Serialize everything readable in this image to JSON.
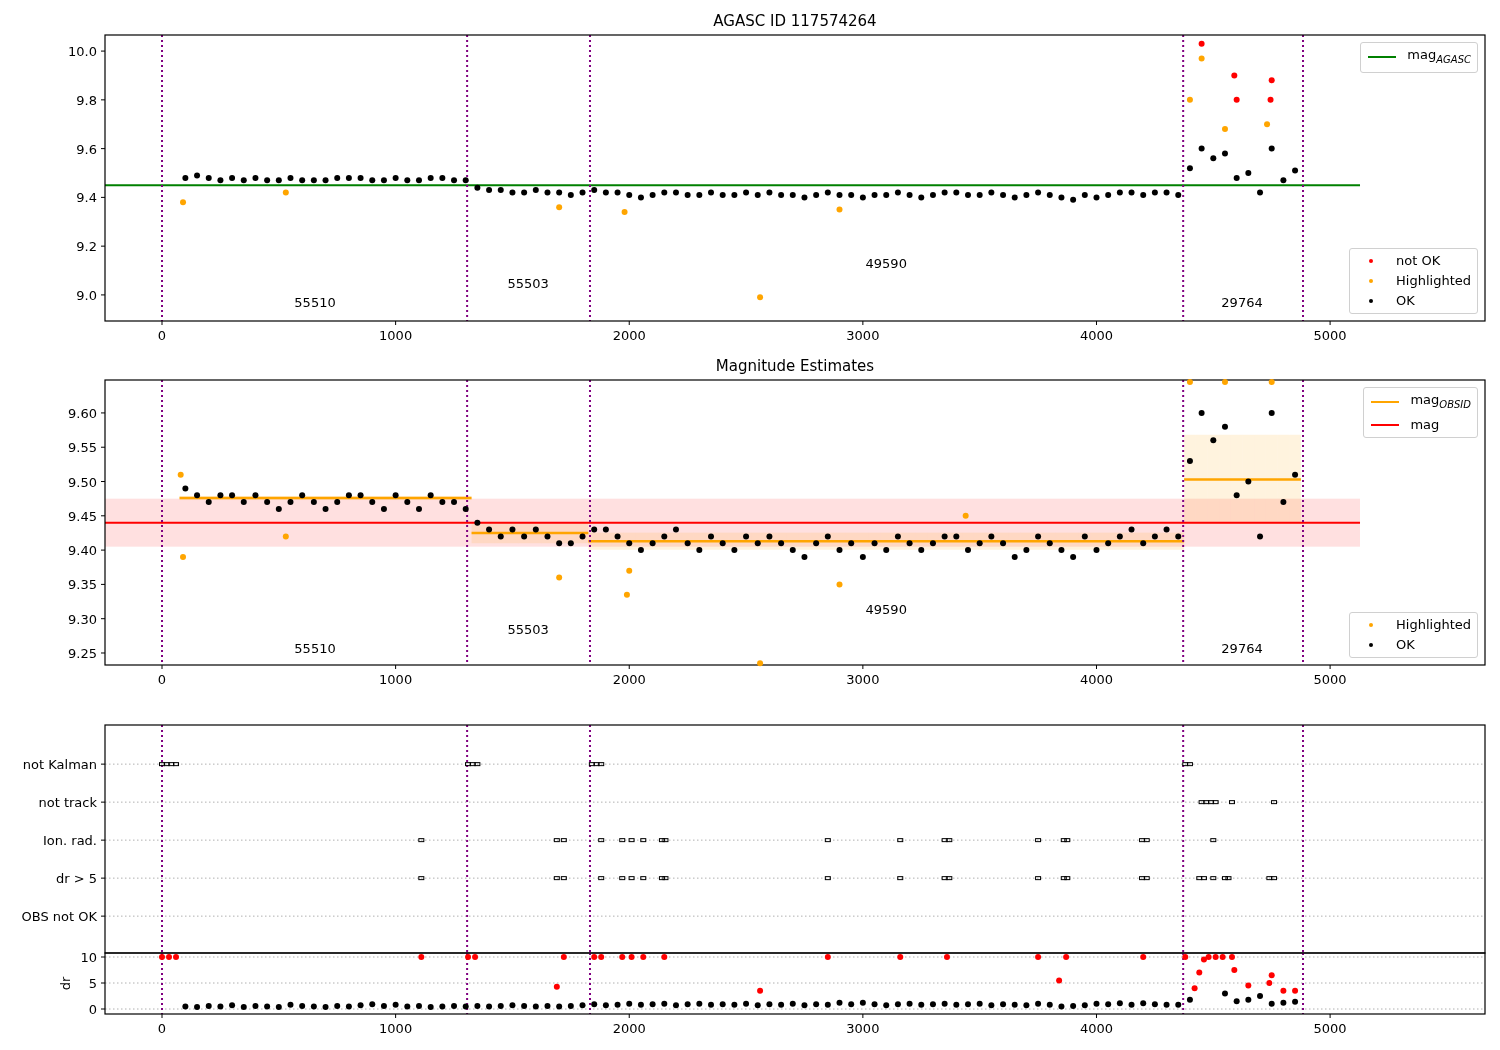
{
  "charts": [
    {
      "chart_data": {
        "type": "scatter",
        "title": "AGASC ID 117574264",
        "legend": true,
        "xlim": [
          -244,
          5663
        ],
        "ylim": [
          8.893,
          10.066
        ],
        "xticks": [
          0,
          1000,
          2000,
          3000,
          4000,
          5000
        ],
        "yticks": [
          {
            "value": 9,
            "label": "9.0"
          },
          {
            "value": 9.2,
            "label": "9.2"
          },
          {
            "value": 9.4,
            "label": "9.4"
          },
          {
            "value": 9.6,
            "label": "9.6"
          },
          {
            "value": 9.8,
            "label": "9.8"
          },
          {
            "value": 10,
            "label": "10.0"
          }
        ],
        "series": [
          {
            "name": "not OK",
            "color": "#ff0000",
            "x": [
              4450,
              4590,
              4600,
              4745,
              4750
            ],
            "values": [
              10.03,
              9.9,
              9.8,
              9.8,
              9.88
            ]
          },
          {
            "name": "Highlighted",
            "color": "#ffa500",
            "x": [
              90,
              530,
              1700,
              1980,
              2560,
              2900,
              4400,
              4450,
              4550,
              4730
            ],
            "values": [
              9.38,
              9.42,
              9.36,
              9.34,
              8.99,
              9.35,
              9.8,
              9.97,
              9.68,
              9.7
            ]
          },
          {
            "name": "OK",
            "color": "#000000",
            "x": [
              100,
              150,
              200,
              250,
              300,
              350,
              400,
              450,
              500,
              550,
              600,
              650,
              700,
              750,
              800,
              850,
              900,
              950,
              1000,
              1050,
              1100,
              1150,
              1200,
              1250,
              1300,
              1350,
              1400,
              1450,
              1500,
              1550,
              1600,
              1650,
              1700,
              1750,
              1800,
              1850,
              1900,
              1950,
              2000,
              2050,
              2100,
              2150,
              2200,
              2250,
              2300,
              2350,
              2400,
              2450,
              2500,
              2550,
              2600,
              2650,
              2700,
              2750,
              2800,
              2850,
              2900,
              2950,
              3000,
              3050,
              3100,
              3150,
              3200,
              3250,
              3300,
              3350,
              3400,
              3450,
              3500,
              3550,
              3600,
              3650,
              3700,
              3750,
              3800,
              3850,
              3900,
              3950,
              4000,
              4050,
              4100,
              4150,
              4200,
              4250,
              4300,
              4350,
              4400,
              4450,
              4500,
              4550,
              4600,
              4650,
              4700,
              4750,
              4800,
              4850
            ],
            "values": [
              9.48,
              9.49,
              9.48,
              9.47,
              9.48,
              9.47,
              9.48,
              9.47,
              9.47,
              9.48,
              9.47,
              9.47,
              9.47,
              9.48,
              9.48,
              9.48,
              9.47,
              9.47,
              9.48,
              9.47,
              9.47,
              9.48,
              9.48,
              9.47,
              9.47,
              9.44,
              9.43,
              9.43,
              9.42,
              9.42,
              9.43,
              9.42,
              9.42,
              9.41,
              9.42,
              9.43,
              9.42,
              9.42,
              9.41,
              9.4,
              9.41,
              9.42,
              9.42,
              9.41,
              9.41,
              9.42,
              9.41,
              9.41,
              9.42,
              9.41,
              9.42,
              9.41,
              9.41,
              9.4,
              9.41,
              9.42,
              9.41,
              9.41,
              9.4,
              9.41,
              9.41,
              9.42,
              9.41,
              9.4,
              9.41,
              9.42,
              9.42,
              9.41,
              9.41,
              9.42,
              9.41,
              9.4,
              9.41,
              9.42,
              9.41,
              9.4,
              9.39,
              9.41,
              9.4,
              9.41,
              9.42,
              9.42,
              9.41,
              9.42,
              9.42,
              9.41,
              9.52,
              9.6,
              9.56,
              9.58,
              9.48,
              9.5,
              9.42,
              9.6,
              9.47,
              9.51
            ]
          }
        ],
        "ref_lines": [
          {
            "axis": "y",
            "value": 9.45,
            "color": "#008000",
            "label": "mag$_{AGASC}$"
          },
          {
            "axis": "x",
            "value": 0,
            "color": "#800080"
          },
          {
            "axis": "x",
            "value": 1306,
            "color": "#800080"
          },
          {
            "axis": "x",
            "value": 1832,
            "color": "#800080"
          },
          {
            "axis": "x",
            "value": 4371,
            "color": "#800080"
          },
          {
            "axis": "x",
            "value": 4884,
            "color": "#800080"
          }
        ],
        "annotations": [
          "55510",
          "55503",
          "49590",
          "29764"
        ]
      }
    },
    {
      "chart_data": {
        "type": "scatter",
        "title": "Magnitude Estimates",
        "legend": true,
        "xlim": [
          -244,
          5663
        ],
        "ylim": [
          9.2325,
          9.648
        ],
        "xticks": [
          0,
          1000,
          2000,
          3000,
          4000,
          5000
        ],
        "yticks": [
          {
            "value": 9.25,
            "label": "9.25"
          },
          {
            "value": 9.3,
            "label": "9.30"
          },
          {
            "value": 9.35,
            "label": "9.35"
          },
          {
            "value": 9.4,
            "label": "9.40"
          },
          {
            "value": 9.45,
            "label": "9.45"
          },
          {
            "value": 9.5,
            "label": "9.50"
          },
          {
            "value": 9.55,
            "label": "9.55"
          },
          {
            "value": 9.6,
            "label": "9.60"
          }
        ],
        "series": [
          {
            "name": "mag$_{OBSID}$",
            "type": "line",
            "color": "#ffa500",
            "x": [
              100,
              150,
              200,
              250,
              300,
              350,
              400,
              450,
              500,
              550,
              600,
              650,
              700,
              750,
              800,
              850,
              900,
              950,
              1000,
              1050,
              1100,
              1150,
              1200,
              1250,
              1300,
              1350,
              1400,
              1450,
              1500,
              1550,
              1600,
              1650,
              1700,
              1750,
              1800,
              1850,
              1900,
              1950,
              2000,
              2050,
              2100,
              2150,
              2200,
              2250,
              2300,
              2350,
              2400,
              2450,
              2500,
              2550,
              2600,
              2650,
              2700,
              2750,
              2800,
              2850,
              2900,
              2950,
              3000,
              3050,
              3100,
              3150,
              3200,
              3250,
              3300,
              3350,
              3400,
              3450,
              3500,
              3550,
              3600,
              3650,
              3700,
              3750,
              3800,
              3850,
              3900,
              3950,
              4000,
              4050,
              4100,
              4150,
              4200,
              4250,
              4300,
              4350,
              4400,
              4450,
              4500,
              4550,
              4600,
              4650,
              4700,
              4750,
              4800,
              4850
            ],
            "values": [
              9.476,
              9.476,
              9.476,
              9.476,
              9.476,
              9.476,
              9.476,
              9.476,
              9.476,
              9.476,
              9.476,
              9.476,
              9.476,
              9.476,
              9.476,
              9.476,
              9.476,
              9.476,
              9.476,
              9.476,
              9.476,
              9.476,
              9.476,
              9.476,
              9.476,
              9.425,
              9.425,
              9.425,
              9.425,
              9.425,
              9.425,
              9.425,
              9.425,
              9.425,
              9.425,
              9.413,
              9.413,
              9.413,
              9.413,
              9.413,
              9.413,
              9.413,
              9.413,
              9.413,
              9.413,
              9.413,
              9.413,
              9.413,
              9.413,
              9.413,
              9.413,
              9.413,
              9.413,
              9.413,
              9.413,
              9.413,
              9.413,
              9.413,
              9.413,
              9.413,
              9.413,
              9.413,
              9.413,
              9.413,
              9.413,
              9.413,
              9.413,
              9.413,
              9.413,
              9.413,
              9.413,
              9.413,
              9.413,
              9.413,
              9.413,
              9.413,
              9.413,
              9.413,
              9.413,
              9.413,
              9.413,
              9.413,
              9.413,
              9.413,
              9.413,
              9.413,
              9.503,
              9.503,
              9.503,
              9.503,
              9.503,
              9.503,
              9.503,
              9.503,
              9.503,
              9.503
            ],
            "errors": [
              0.003,
              0.003,
              0.003,
              0.003,
              0.003,
              0.003,
              0.003,
              0.003,
              0.003,
              0.003,
              0.003,
              0.003,
              0.003,
              0.003,
              0.003,
              0.003,
              0.003,
              0.003,
              0.003,
              0.003,
              0.003,
              0.003,
              0.003,
              0.003,
              0.003,
              0.015,
              0.015,
              0.015,
              0.015,
              0.015,
              0.015,
              0.015,
              0.015,
              0.015,
              0.015,
              0.0125,
              0.0125,
              0.0125,
              0.0125,
              0.0125,
              0.0125,
              0.0125,
              0.0125,
              0.0125,
              0.0125,
              0.0125,
              0.0125,
              0.0125,
              0.0125,
              0.0125,
              0.0125,
              0.0125,
              0.0125,
              0.0125,
              0.0125,
              0.0125,
              0.0125,
              0.0125,
              0.0125,
              0.0125,
              0.0125,
              0.0125,
              0.0125,
              0.0125,
              0.0125,
              0.0125,
              0.0125,
              0.0125,
              0.0125,
              0.0125,
              0.0125,
              0.0125,
              0.0125,
              0.0125,
              0.0125,
              0.0125,
              0.0125,
              0.0125,
              0.0125,
              0.0125,
              0.0125,
              0.0125,
              0.0125,
              0.0125,
              0.0125,
              0.0125,
              0.065,
              0.065,
              0.065,
              0.065,
              0.065,
              0.065,
              0.065,
              0.065,
              0.065,
              0.065
            ]
          },
          {
            "name": "Highlighted",
            "color": "#ffa500",
            "x": [
              80,
              90,
              530,
              1700,
              1990,
              2000,
              2560,
              2900,
              3440,
              4400,
              4550,
              4750
            ],
            "values": [
              9.51,
              9.39,
              9.42,
              9.36,
              9.335,
              9.37,
              9.235,
              9.35,
              9.45,
              9.645,
              9.645,
              9.645
            ]
          },
          {
            "name": "OK",
            "color": "#000000",
            "x": [
              100,
              150,
              200,
              250,
              300,
              350,
              400,
              450,
              500,
              550,
              600,
              650,
              700,
              750,
              800,
              850,
              900,
              950,
              1000,
              1050,
              1100,
              1150,
              1200,
              1250,
              1300,
              1350,
              1400,
              1450,
              1500,
              1550,
              1600,
              1650,
              1700,
              1750,
              1800,
              1850,
              1900,
              1950,
              2000,
              2050,
              2100,
              2150,
              2200,
              2250,
              2300,
              2350,
              2400,
              2450,
              2500,
              2550,
              2600,
              2650,
              2700,
              2750,
              2800,
              2850,
              2900,
              2950,
              3000,
              3050,
              3100,
              3150,
              3200,
              3250,
              3300,
              3350,
              3400,
              3450,
              3500,
              3550,
              3600,
              3650,
              3700,
              3750,
              3800,
              3850,
              3900,
              3950,
              4000,
              4050,
              4100,
              4150,
              4200,
              4250,
              4300,
              4350,
              4400,
              4450,
              4500,
              4550,
              4600,
              4650,
              4700,
              4750,
              4800,
              4850
            ],
            "values": [
              9.49,
              9.48,
              9.47,
              9.48,
              9.48,
              9.47,
              9.48,
              9.47,
              9.46,
              9.47,
              9.48,
              9.47,
              9.46,
              9.47,
              9.48,
              9.48,
              9.47,
              9.46,
              9.48,
              9.47,
              9.46,
              9.48,
              9.47,
              9.47,
              9.46,
              9.44,
              9.43,
              9.42,
              9.43,
              9.42,
              9.43,
              9.42,
              9.41,
              9.41,
              9.42,
              9.43,
              9.43,
              9.42,
              9.41,
              9.4,
              9.41,
              9.42,
              9.43,
              9.41,
              9.4,
              9.42,
              9.41,
              9.4,
              9.42,
              9.41,
              9.42,
              9.41,
              9.4,
              9.39,
              9.41,
              9.42,
              9.4,
              9.41,
              9.39,
              9.41,
              9.4,
              9.42,
              9.41,
              9.4,
              9.41,
              9.42,
              9.42,
              9.4,
              9.41,
              9.42,
              9.41,
              9.39,
              9.4,
              9.42,
              9.41,
              9.4,
              9.39,
              9.42,
              9.4,
              9.41,
              9.42,
              9.43,
              9.41,
              9.42,
              9.43,
              9.42,
              9.53,
              9.6,
              9.56,
              9.58,
              9.48,
              9.5,
              9.42,
              9.6,
              9.47,
              9.51
            ]
          }
        ],
        "ref_lines": [
          {
            "axis": "y",
            "value": 9.44,
            "color": "#ff0000",
            "label": "mag"
          },
          {
            "axis": "x",
            "value": 0,
            "color": "#800080"
          },
          {
            "axis": "x",
            "value": 1306,
            "color": "#800080"
          },
          {
            "axis": "x",
            "value": 1832,
            "color": "#800080"
          },
          {
            "axis": "x",
            "value": 4371,
            "color": "#800080"
          },
          {
            "axis": "x",
            "value": 4884,
            "color": "#800080"
          }
        ],
        "bands": [
          {
            "axis": "y",
            "from": 9.405,
            "to": 9.475,
            "color": "#ff0000"
          }
        ],
        "annotations": [
          "55510",
          "55503",
          "49590",
          "29764"
        ]
      }
    },
    {
      "chart_data": {
        "type": "scatter",
        "grid": true,
        "orientation": "horizontal",
        "xlim": [
          -244,
          5663
        ],
        "categories": [
          "not Kalman",
          "not track",
          "Ion. rad.",
          "dr > 5",
          "OBS not OK"
        ],
        "series": [
          {
            "color": "#000000",
            "values": [
              0,
              4450,
              1110,
              1110,
              null
            ]
          },
          {
            "color": "#000000",
            "values": [
              20,
              4470,
              1690,
              1690,
              null
            ]
          },
          {
            "color": "#000000",
            "values": [
              40,
              4490,
              1720,
              1720,
              null
            ]
          },
          {
            "color": "#000000",
            "values": [
              60,
              4510,
              1880,
              1880,
              null
            ]
          },
          {
            "color": "#000000",
            "values": [
              1310,
              4580,
              1970,
              1970,
              null
            ]
          },
          {
            "color": "#000000",
            "values": [
              1330,
              4760,
              2010,
              2010,
              null
            ]
          },
          {
            "color": "#000000",
            "values": [
              1350,
              null,
              2060,
              2060,
              null
            ]
          },
          {
            "color": "#000000",
            "values": [
              1840,
              null,
              2140,
              2140,
              null
            ]
          },
          {
            "color": "#000000",
            "values": [
              1860,
              null,
              2155,
              2155,
              null
            ]
          },
          {
            "color": "#000000",
            "values": [
              1880,
              null,
              2850,
              2850,
              null
            ]
          },
          {
            "color": "#000000",
            "values": [
              4380,
              null,
              3160,
              3160,
              null
            ]
          },
          {
            "color": "#000000",
            "values": [
              4400,
              null,
              3350,
              3350,
              null
            ]
          },
          {
            "color": "#000000",
            "values": [
              null,
              null,
              3370,
              3370,
              null
            ]
          },
          {
            "color": "#000000",
            "values": [
              null,
              null,
              3750,
              3750,
              null
            ]
          },
          {
            "color": "#000000",
            "values": [
              null,
              null,
              3860,
              3860,
              null
            ]
          },
          {
            "color": "#000000",
            "values": [
              null,
              null,
              3875,
              3875,
              null
            ]
          },
          {
            "color": "#000000",
            "values": [
              null,
              null,
              4195,
              4195,
              null
            ]
          },
          {
            "color": "#000000",
            "values": [
              null,
              null,
              4215,
              4215,
              null
            ]
          },
          {
            "color": "#000000",
            "values": [
              null,
              null,
              4500,
              4440,
              null
            ]
          },
          {
            "color": "#000000",
            "values": [
              null,
              null,
              null,
              4460,
              null
            ]
          },
          {
            "color": "#000000",
            "values": [
              null,
              null,
              null,
              4500,
              null
            ]
          },
          {
            "color": "#000000",
            "values": [
              null,
              null,
              null,
              4550,
              null
            ]
          },
          {
            "color": "#000000",
            "values": [
              null,
              null,
              null,
              4565,
              null
            ]
          },
          {
            "color": "#000000",
            "values": [
              null,
              null,
              null,
              4740,
              null
            ]
          },
          {
            "color": "#000000",
            "values": [
              null,
              null,
              null,
              4760,
              null
            ]
          }
        ],
        "ref_lines": [
          {
            "axis": "x",
            "value": 0,
            "color": "#800080"
          },
          {
            "axis": "x",
            "value": 1306,
            "color": "#800080"
          },
          {
            "axis": "x",
            "value": 1832,
            "color": "#800080"
          },
          {
            "axis": "x",
            "value": 4371,
            "color": "#800080"
          },
          {
            "axis": "x",
            "value": 4884,
            "color": "#800080"
          }
        ]
      }
    },
    {
      "chart_data": {
        "type": "scatter",
        "grid": true,
        "ylabel": "dr",
        "xlim": [
          -244,
          5663
        ],
        "ylim": [
          -0.96,
          10.77
        ],
        "xticks": [
          0,
          1000,
          2000,
          3000,
          4000,
          5000
        ],
        "yticks": [
          0,
          5,
          10
        ],
        "series": [
          {
            "color": "#000000",
            "x": [
              100,
              150,
              200,
              250,
              300,
              350,
              400,
              450,
              500,
              550,
              600,
              650,
              700,
              750,
              800,
              850,
              900,
              950,
              1000,
              1050,
              1100,
              1150,
              1200,
              1250,
              1300,
              1350,
              1400,
              1450,
              1500,
              1550,
              1600,
              1650,
              1700,
              1750,
              1800,
              1850,
              1900,
              1950,
              2000,
              2050,
              2100,
              2150,
              2200,
              2250,
              2300,
              2350,
              2400,
              2450,
              2500,
              2550,
              2600,
              2650,
              2700,
              2750,
              2800,
              2850,
              2900,
              2950,
              3000,
              3050,
              3100,
              3150,
              3200,
              3250,
              3300,
              3350,
              3400,
              3450,
              3500,
              3550,
              3600,
              3650,
              3700,
              3750,
              3800,
              3850,
              3900,
              3950,
              4000,
              4050,
              4100,
              4150,
              4200,
              4250,
              4300,
              4350,
              4400,
              4550,
              4600,
              4650,
              4700,
              4750,
              4800,
              4850
            ],
            "values": [
              0.5,
              0.4,
              0.6,
              0.5,
              0.7,
              0.4,
              0.6,
              0.5,
              0.4,
              0.8,
              0.6,
              0.5,
              0.4,
              0.6,
              0.5,
              0.7,
              0.9,
              0.6,
              0.8,
              0.5,
              0.6,
              0.4,
              0.5,
              0.6,
              0.5,
              0.6,
              0.5,
              0.6,
              0.7,
              0.6,
              0.5,
              0.6,
              0.5,
              0.6,
              0.7,
              0.9,
              0.7,
              0.8,
              1.0,
              0.8,
              0.9,
              1.0,
              0.7,
              0.9,
              1.0,
              0.8,
              0.9,
              0.8,
              1.0,
              0.7,
              0.9,
              0.8,
              1.0,
              0.7,
              0.9,
              0.8,
              1.2,
              0.9,
              1.2,
              0.9,
              0.7,
              0.9,
              1.0,
              0.8,
              0.9,
              1.0,
              0.8,
              0.9,
              1.0,
              0.7,
              0.9,
              0.8,
              0.7,
              1.0,
              0.8,
              0.5,
              0.6,
              0.7,
              1.0,
              0.9,
              1.1,
              0.8,
              1.1,
              0.9,
              0.8,
              0.8,
              1.8,
              3.0,
              1.5,
              1.8,
              2.5,
              1.0,
              1.2,
              1.4
            ]
          },
          {
            "color": "#ff0000",
            "x": [
              0,
              30,
              60,
              1110,
              1310,
              1340,
              1690,
              1720,
              1850,
              1880,
              1970,
              2010,
              2060,
              2150,
              2560,
              2850,
              3160,
              3360,
              3750,
              3840,
              3870,
              4200,
              4380,
              4420,
              4440,
              4460,
              4480,
              4510,
              4540,
              4580,
              4590,
              4650,
              4740,
              4750,
              4800,
              4850
            ],
            "values": [
              10,
              10,
              10,
              10,
              10,
              10,
              4.3,
              10,
              10,
              10,
              10,
              10,
              10,
              10,
              3.5,
              10,
              10,
              10,
              10,
              5.5,
              10,
              10,
              10,
              4,
              7,
              9.5,
              10,
              10,
              10,
              10,
              7.5,
              4.5,
              5,
              6.5,
              3.5,
              3.5
            ]
          }
        ],
        "ref_lines": [
          {
            "axis": "x",
            "value": 0,
            "color": "#800080"
          },
          {
            "axis": "x",
            "value": 1306,
            "color": "#800080"
          },
          {
            "axis": "x",
            "value": 1832,
            "color": "#800080"
          },
          {
            "axis": "x",
            "value": 4371,
            "color": "#800080"
          },
          {
            "axis": "x",
            "value": 4884,
            "color": "#800080"
          }
        ]
      }
    }
  ]
}
